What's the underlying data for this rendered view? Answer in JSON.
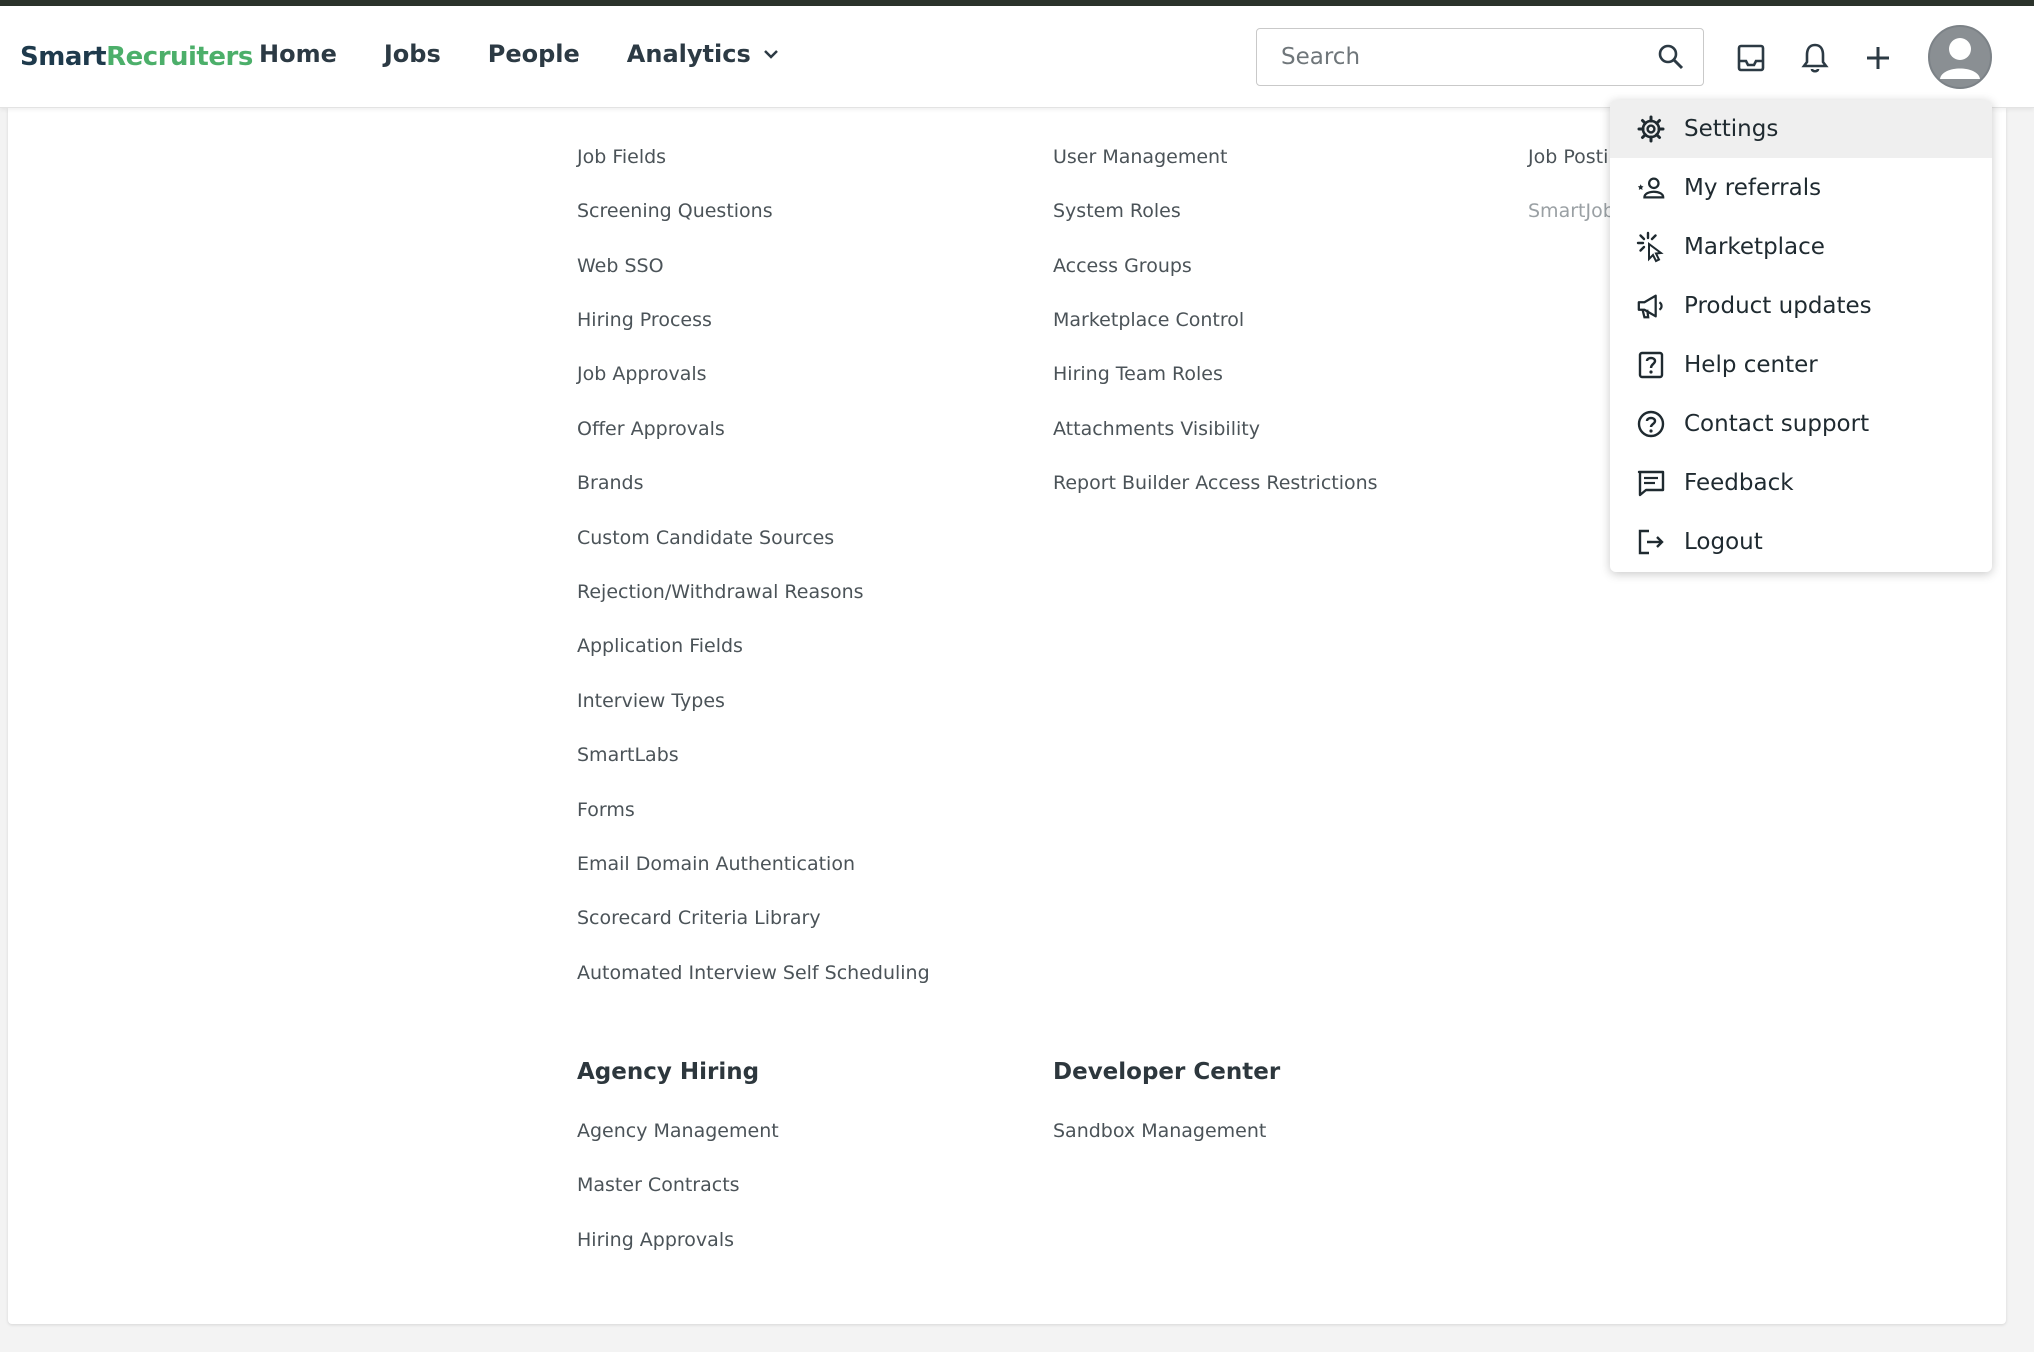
{
  "header": {
    "logo_part1": "Smart",
    "logo_part2": "Recruiters",
    "nav": [
      "Home",
      "Jobs",
      "People",
      "Analytics"
    ],
    "search_placeholder": "Search",
    "icons": [
      "search-icon",
      "inbox-icon",
      "bell-icon",
      "plus-icon",
      "avatar"
    ]
  },
  "columns": {
    "col1": {
      "links": [
        "Job Fields",
        "Screening Questions",
        "Web SSO",
        "Hiring Process",
        "Job Approvals",
        "Offer Approvals",
        "Brands",
        "Custom Candidate Sources",
        "Rejection/Withdrawal Reasons",
        "Application Fields",
        "Interview Types",
        "SmartLabs",
        "Forms",
        "Email Domain Authentication",
        "Scorecard Criteria Library",
        "Automated Interview Self Scheduling"
      ]
    },
    "col2": {
      "links": [
        "User Management",
        "System Roles",
        "Access Groups",
        "Marketplace Control",
        "Hiring Team Roles",
        "Attachments Visibility",
        "Report Builder Access Restrictions"
      ]
    },
    "col3": {
      "links": [
        "Job Postir",
        "SmartJob"
      ]
    }
  },
  "sections": {
    "agency": {
      "title": "Agency Hiring",
      "links": [
        "Agency Management",
        "Master Contracts",
        "Hiring Approvals"
      ]
    },
    "developer": {
      "title": "Developer Center",
      "links": [
        "Sandbox Management"
      ]
    }
  },
  "dropdown": {
    "items": [
      {
        "label": "Settings",
        "icon": "gear-icon"
      },
      {
        "label": "My referrals",
        "icon": "referral-icon"
      },
      {
        "label": "Marketplace",
        "icon": "marketplace-icon"
      },
      {
        "label": "Product updates",
        "icon": "megaphone-icon"
      },
      {
        "label": "Help center",
        "icon": "help-icon"
      },
      {
        "label": "Contact support",
        "icon": "support-icon"
      },
      {
        "label": "Feedback",
        "icon": "feedback-icon"
      },
      {
        "label": "Logout",
        "icon": "logout-icon"
      }
    ]
  },
  "colors": {
    "brand_dark": "#1e3a4c",
    "brand_green": "#4caf6a",
    "top_stripe": "#2b332b"
  }
}
